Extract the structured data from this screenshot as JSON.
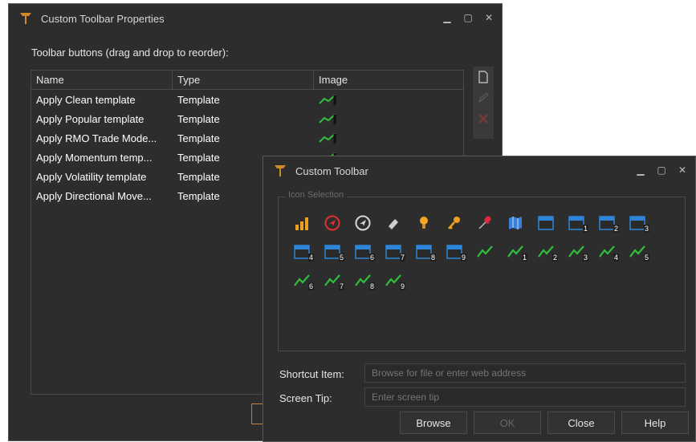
{
  "props_window": {
    "title": "Custom Toolbar Properties",
    "instruction": "Toolbar buttons (drag and drop to reorder):",
    "columns": [
      "Name",
      "Type",
      "Image"
    ],
    "rows": [
      {
        "name": "Apply Clean template",
        "type": "Template"
      },
      {
        "name": "Apply Popular template",
        "type": "Template"
      },
      {
        "name": "Apply RMO Trade Mode...",
        "type": "Template"
      },
      {
        "name": "Apply Momentum temp...",
        "type": "Template"
      },
      {
        "name": "Apply Volatility template",
        "type": "Template"
      },
      {
        "name": "Apply Directional Move...",
        "type": "Template"
      }
    ],
    "side_tools": [
      "new-icon",
      "edit-icon",
      "delete-icon"
    ]
  },
  "toolbar_window": {
    "title": "Custom Toolbar",
    "group_label": "Icon Selection",
    "icons": [
      {
        "name": "bar-chart-icon",
        "badge": ""
      },
      {
        "name": "red-navigation-icon",
        "badge": ""
      },
      {
        "name": "navigation-icon",
        "badge": ""
      },
      {
        "name": "eraser-icon",
        "badge": ""
      },
      {
        "name": "lightbulb-icon",
        "badge": ""
      },
      {
        "name": "key-icon",
        "badge": ""
      },
      {
        "name": "pin-icon",
        "badge": ""
      },
      {
        "name": "map-icon",
        "badge": ""
      },
      {
        "name": "window-icon",
        "badge": ""
      },
      {
        "name": "window-icon",
        "badge": "1"
      },
      {
        "name": "window-icon",
        "badge": "2"
      },
      {
        "name": "window-icon",
        "badge": "3"
      },
      {
        "name": "window-icon",
        "badge": "4"
      },
      {
        "name": "window-icon",
        "badge": "5"
      },
      {
        "name": "window-icon",
        "badge": "6"
      },
      {
        "name": "window-icon",
        "badge": "7"
      },
      {
        "name": "window-icon",
        "badge": "8"
      },
      {
        "name": "window-icon",
        "badge": "9"
      },
      {
        "name": "chart-icon",
        "badge": ""
      },
      {
        "name": "chart-icon",
        "badge": "1"
      },
      {
        "name": "chart-icon",
        "badge": "2"
      },
      {
        "name": "chart-icon",
        "badge": "3"
      },
      {
        "name": "chart-icon",
        "badge": "4"
      },
      {
        "name": "chart-icon",
        "badge": "5"
      },
      {
        "name": "chart-icon",
        "badge": "6"
      },
      {
        "name": "chart-icon",
        "badge": "7"
      },
      {
        "name": "chart-icon",
        "badge": "8"
      },
      {
        "name": "chart-icon",
        "badge": "9"
      }
    ],
    "shortcut_label": "Shortcut Item:",
    "shortcut_placeholder": "Browse for file or enter web address",
    "screentip_label": "Screen Tip:",
    "screentip_placeholder": "Enter screen tip",
    "buttons": {
      "browse": "Browse",
      "ok": "OK",
      "close": "Close",
      "help": "Help"
    }
  },
  "colors": {
    "background": "#2d2d2d",
    "chart_green": "#2fbf3a",
    "window_blue": "#2d86d9",
    "accent_orange": "#f0a020"
  }
}
